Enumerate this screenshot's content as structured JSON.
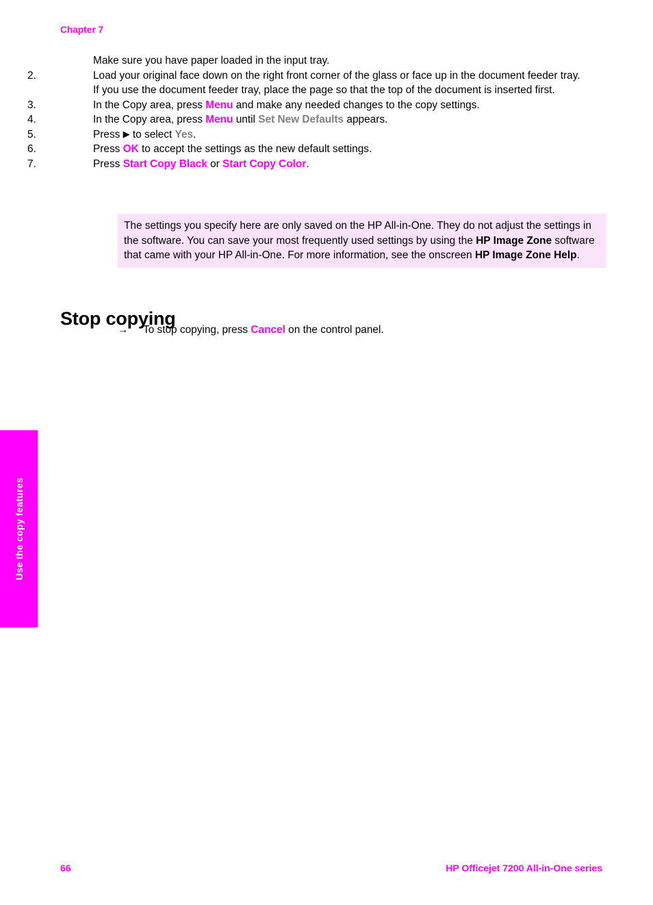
{
  "page": {
    "chapter_label": "Chapter 7",
    "page_number": "66",
    "footer_title": "HP Officejet 7200 All-in-One series",
    "accent_color": "#ff00ff",
    "note_background": "#fbe3fb",
    "gray_ui_color": "#808080"
  },
  "side_tab": {
    "label": "Use the copy features"
  },
  "procedure": {
    "intro_line": "Make sure you have paper loaded in the input tray.",
    "steps": [
      {
        "number": "2.",
        "segments": [
          {
            "text": "Load your original face down on the right front corner of the glass or face up in the document feeder tray.",
            "style": "plain"
          }
        ],
        "continuation": "If you use the document feeder tray, place the page so that the top of the document is inserted first."
      },
      {
        "number": "3.",
        "segments": [
          {
            "text": "In the Copy area, press ",
            "style": "plain"
          },
          {
            "text": "Menu",
            "style": "magenta"
          },
          {
            "text": " and make any needed changes to the copy settings.",
            "style": "plain"
          }
        ]
      },
      {
        "number": "4.",
        "segments": [
          {
            "text": "In the Copy area, press ",
            "style": "plain"
          },
          {
            "text": "Menu",
            "style": "magenta"
          },
          {
            "text": " until ",
            "style": "plain"
          },
          {
            "text": "Set New Defaults",
            "style": "gray"
          },
          {
            "text": " appears.",
            "style": "plain"
          }
        ]
      },
      {
        "number": "5.",
        "segments": [
          {
            "text": "Press ",
            "style": "plain"
          },
          {
            "text": "▶",
            "style": "triangle"
          },
          {
            "text": " to select ",
            "style": "plain"
          },
          {
            "text": "Yes",
            "style": "gray"
          },
          {
            "text": ".",
            "style": "plain"
          }
        ]
      },
      {
        "number": "6.",
        "segments": [
          {
            "text": "Press ",
            "style": "plain"
          },
          {
            "text": "OK",
            "style": "magenta"
          },
          {
            "text": " to accept the settings as the new default settings.",
            "style": "plain"
          }
        ]
      },
      {
        "number": "7.",
        "segments": [
          {
            "text": "Press ",
            "style": "plain"
          },
          {
            "text": "Start Copy Black",
            "style": "magenta"
          },
          {
            "text": " or ",
            "style": "plain"
          },
          {
            "text": "Start Copy Color",
            "style": "magenta"
          },
          {
            "text": ".",
            "style": "plain"
          }
        ]
      }
    ]
  },
  "note": {
    "segments": [
      {
        "text": "The settings you specify here are only saved on the HP All-in-One. They do not adjust the settings in the software. You can save your most frequently used settings by using the ",
        "style": "plain"
      },
      {
        "text": "HP Image Zone",
        "style": "bold"
      },
      {
        "text": " software that came with your HP All-in-One. For more information, see the onscreen ",
        "style": "plain"
      },
      {
        "text": "HP Image Zone Help",
        "style": "bold"
      },
      {
        "text": ".",
        "style": "plain"
      }
    ]
  },
  "section": {
    "title": "Stop copying",
    "bullet_glyph": "→",
    "bullet_segments": [
      {
        "text": "To stop copying, press ",
        "style": "plain"
      },
      {
        "text": "Cancel",
        "style": "magenta"
      },
      {
        "text": " on the control panel.",
        "style": "plain"
      }
    ]
  }
}
